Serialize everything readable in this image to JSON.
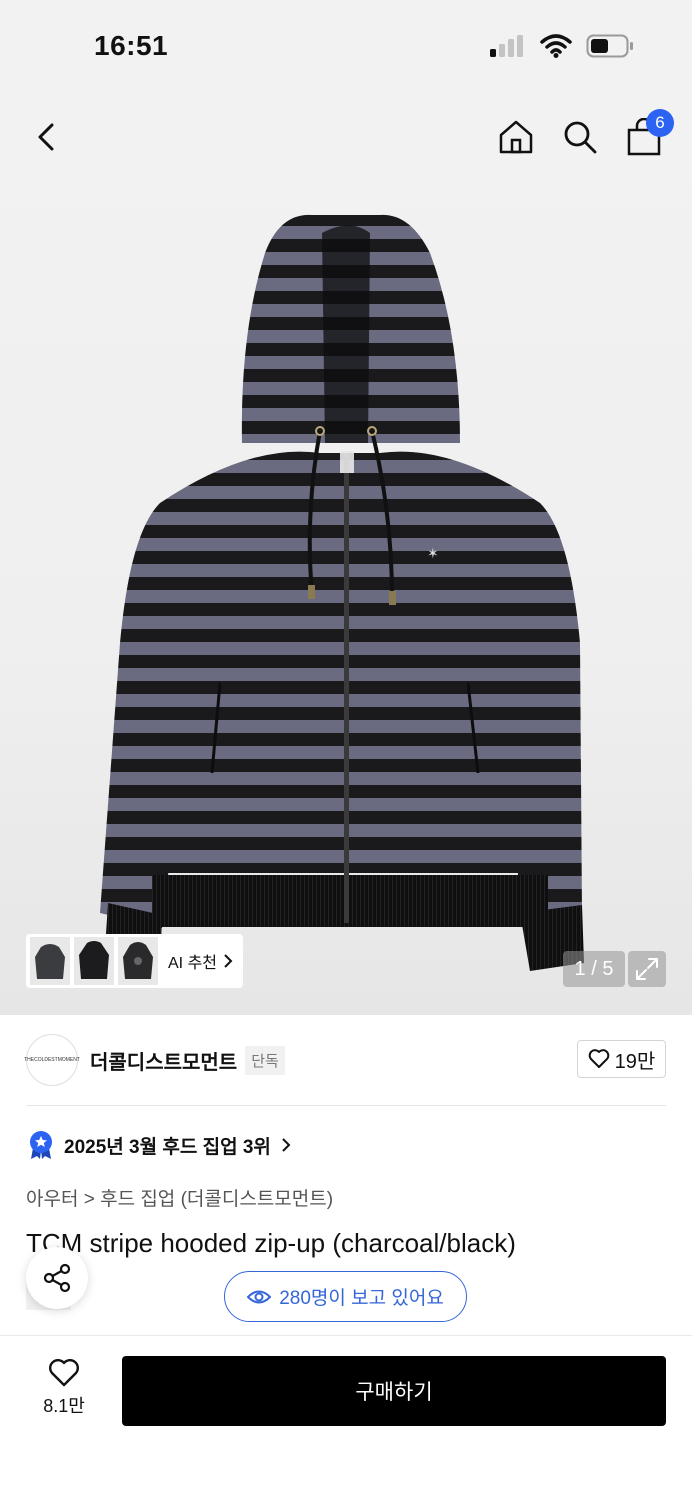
{
  "status_bar": {
    "time": "16:51",
    "signal_icon": "signal-icon",
    "wifi_icon": "wifi-icon",
    "battery_icon": "battery-icon"
  },
  "nav": {
    "cart_count": "6"
  },
  "gallery": {
    "ai_label": "AI 추천",
    "pager": "1 / 5"
  },
  "brand": {
    "name": "더콜디스트모먼트",
    "tag": "단독",
    "likes": "19만",
    "logo_text": "THECOLDESTMOMENT"
  },
  "ranking": {
    "text": "2025년 3월 후드 집업 3위"
  },
  "category": {
    "text": "아우터 > 후드 집업 (더콜디스트모먼트)"
  },
  "product": {
    "title": "TCM stripe hooded zip-up (charcoal/black)",
    "tag": "단독"
  },
  "viewers": {
    "text": "280명이 보고 있어요"
  },
  "bottom": {
    "wish_count": "8.1만",
    "buy_label": "구매하기"
  },
  "colors": {
    "accent": "#2c63f2",
    "viewer_blue": "#3566d8",
    "stripe_purple": "#6a6a80",
    "stripe_black": "#1a1a1d"
  }
}
